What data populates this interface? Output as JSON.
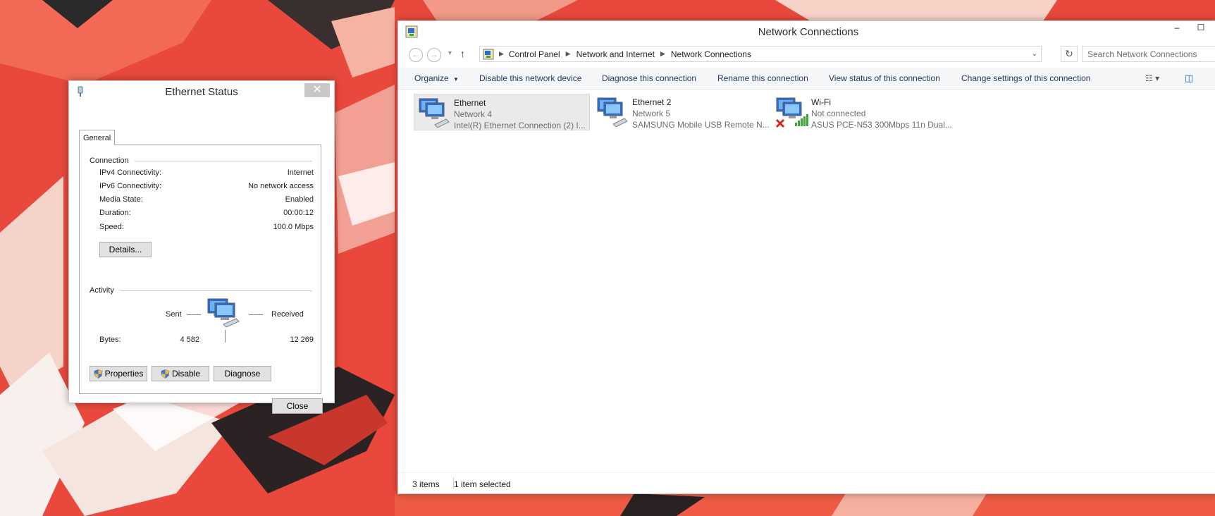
{
  "ethernet_status": {
    "title": "Ethernet Status",
    "tab": "General",
    "connection_heading": "Connection",
    "rows": [
      {
        "label": "IPv4 Connectivity:",
        "value": "Internet"
      },
      {
        "label": "IPv6 Connectivity:",
        "value": "No network access"
      },
      {
        "label": "Media State:",
        "value": "Enabled"
      },
      {
        "label": "Duration:",
        "value": "00:00:12"
      },
      {
        "label": "Speed:",
        "value": "100.0 Mbps"
      }
    ],
    "details_button": "Details...",
    "activity_heading": "Activity",
    "sent_label": "Sent",
    "received_label": "Received",
    "bytes_label": "Bytes:",
    "bytes_sent": "4 582",
    "bytes_received": "12 269",
    "properties_button": "Properties",
    "disable_button": "Disable",
    "diagnose_button": "Diagnose",
    "close_button": "Close",
    "close_x": "✕"
  },
  "network_connections": {
    "title": "Network Connections",
    "caption": {
      "minimize": "–",
      "maximize": "☐"
    },
    "breadcrumb": [
      "Control Panel",
      "Network and Internet",
      "Network Connections"
    ],
    "search_placeholder": "Search Network Connections",
    "toolbar": {
      "organize": "Organize",
      "disable": "Disable this network device",
      "diagnose": "Diagnose this connection",
      "rename": "Rename this connection",
      "view_status": "View status of this connection",
      "change_settings": "Change settings of this connection"
    },
    "connections": [
      {
        "name": "Ethernet",
        "network": "Network  4",
        "device": "Intel(R) Ethernet Connection (2) I...",
        "selected": true
      },
      {
        "name": "Ethernet 2",
        "network": "Network  5",
        "device": "SAMSUNG Mobile USB Remote N..."
      },
      {
        "name": "Wi-Fi",
        "network": "Not connected",
        "device": "ASUS PCE-N53 300Mbps 11n Dual..."
      }
    ],
    "status_items": "3 items",
    "status_selected": "1 item selected"
  },
  "colors": {
    "wallpaper": "#e8493c",
    "accent_link": "#1e395b",
    "selected_bg": "#eaeaea",
    "wifi_x": "#d9261c",
    "signal_green": "#3aa832"
  }
}
